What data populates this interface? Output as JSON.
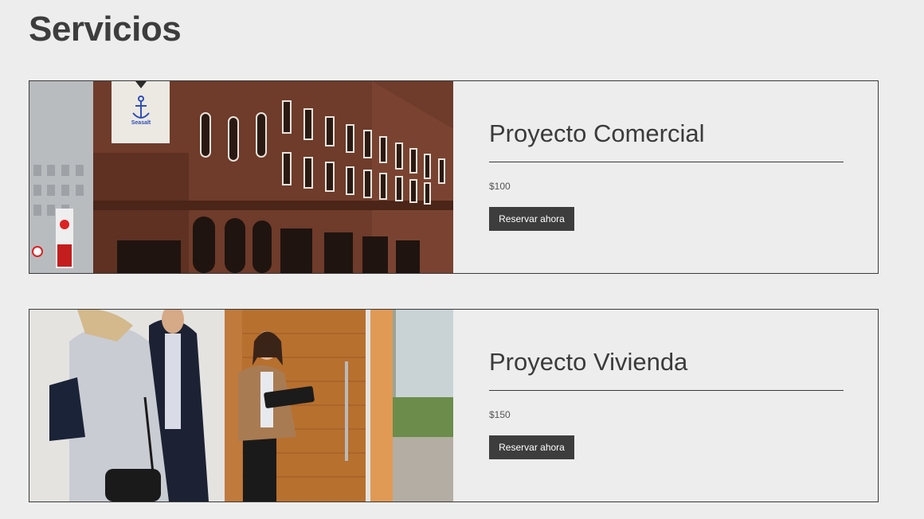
{
  "page": {
    "title": "Servicios"
  },
  "services": [
    {
      "title": "Proyecto Comercial",
      "price": "$100",
      "button_label": "Reservar ahora",
      "image": "brick-building-photo",
      "logo_text": "Seasalt"
    },
    {
      "title": "Proyecto Vivienda",
      "price": "$150",
      "button_label": "Reservar ahora",
      "image": "realtor-greeting-clients-photo"
    }
  ]
}
